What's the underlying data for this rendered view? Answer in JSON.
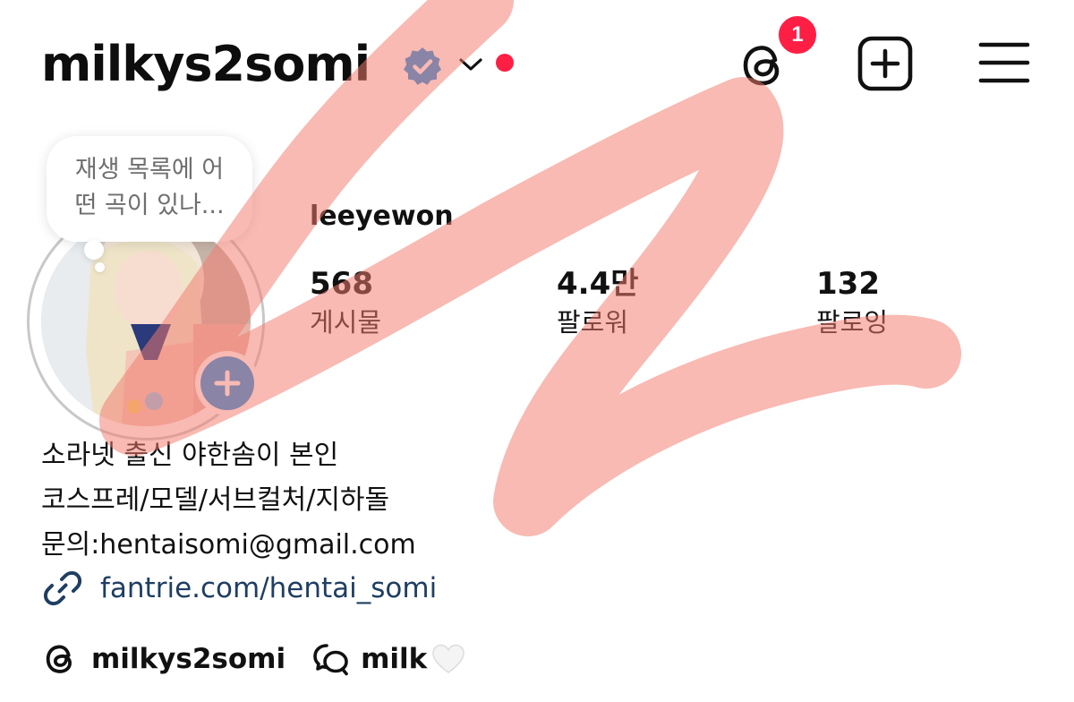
{
  "header": {
    "username": "milkys2somi",
    "verified_icon": "verified-badge-icon",
    "account_switch_icon": "chevron-down-icon",
    "notification_badge_count": "1"
  },
  "note": {
    "text": "재생 목록에 어\n떤 곡이 있나..."
  },
  "profile": {
    "display_name": "leeyewon",
    "stats": [
      {
        "value": "568",
        "label": "게시물"
      },
      {
        "value": "4.4만",
        "label": "팔로워"
      },
      {
        "value": "132",
        "label": "팔로잉"
      }
    ]
  },
  "bio": {
    "lines": [
      "소라넷 출신 야한솜이 본인",
      "코스프레/모델/서브컬처/지하돌",
      "문의:hentaisomi@gmail.com"
    ],
    "link": "fantrie.com/hentai_somi"
  },
  "bottom": {
    "threads_handle": "milkys2somi",
    "channel_name": "milk"
  },
  "colors": {
    "accent_blue": "#1a8fe3",
    "link_blue": "#1f3e62",
    "notif_red": "#ff1f45",
    "status_red": "#ff1f45",
    "scribble": "#f17b6d"
  }
}
